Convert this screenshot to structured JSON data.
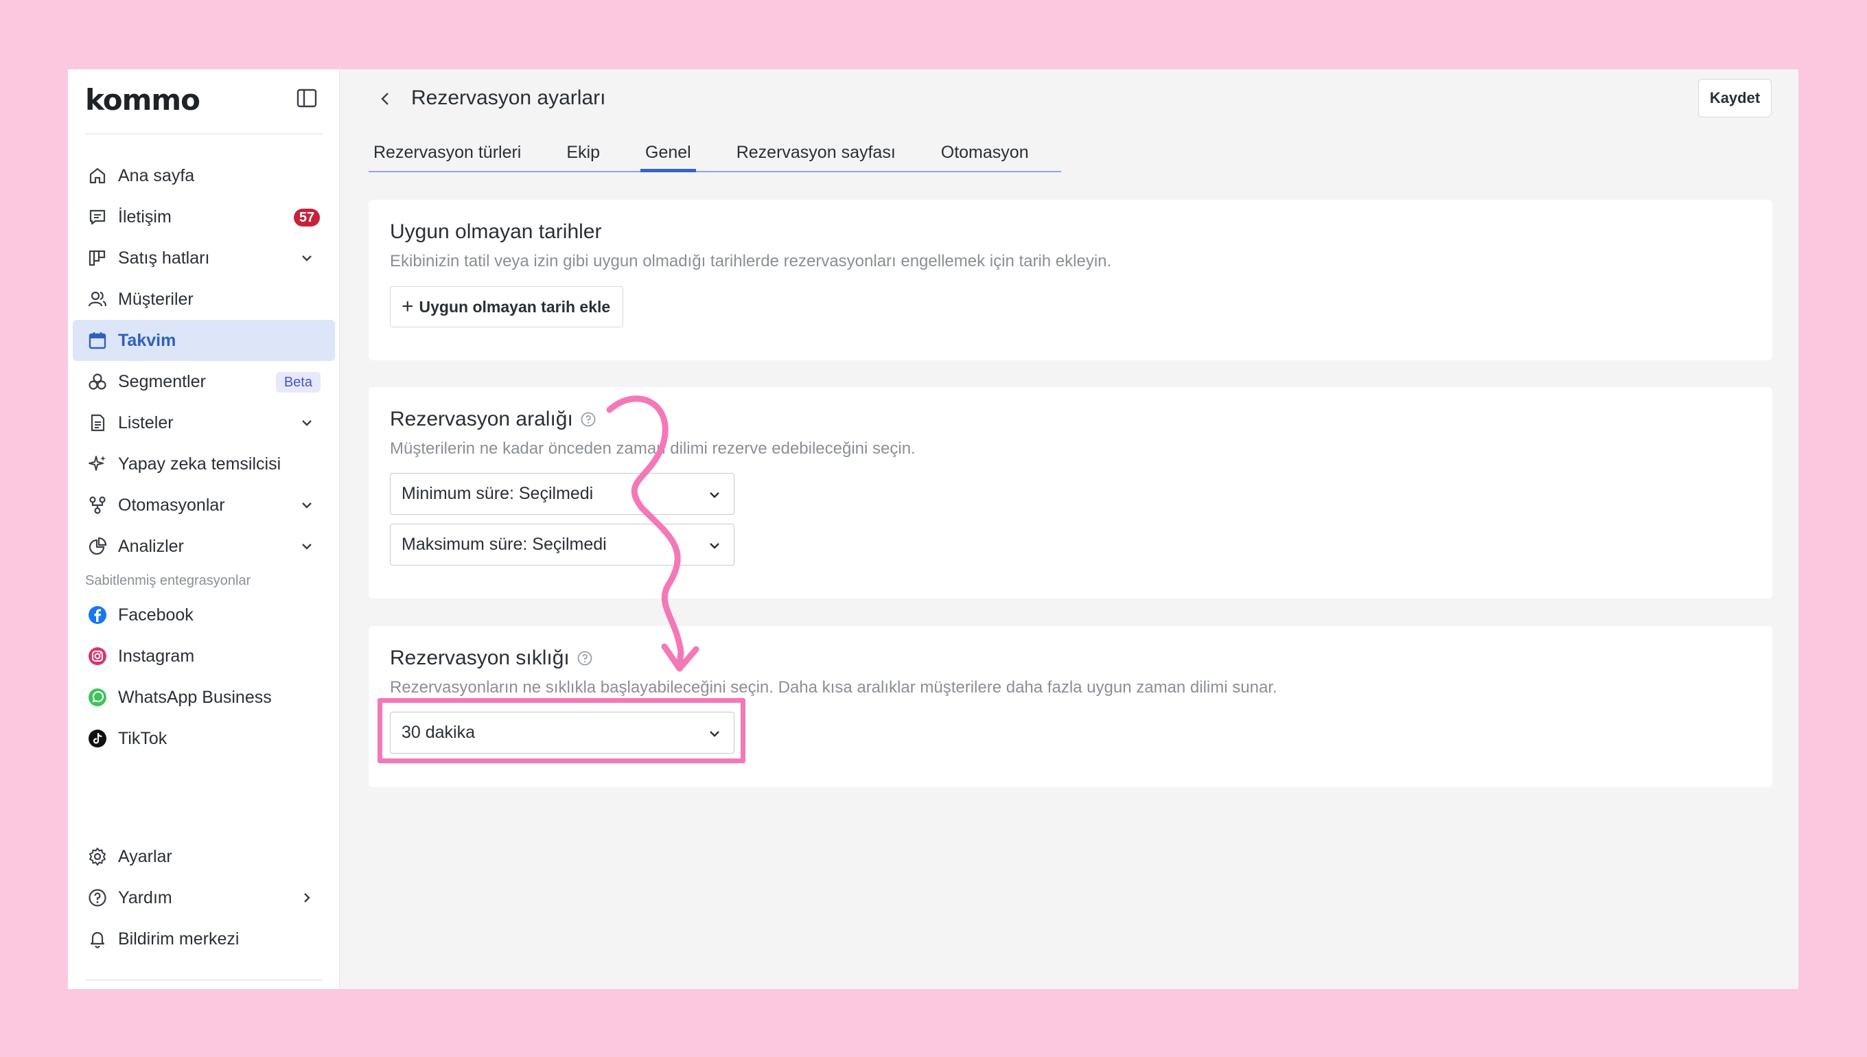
{
  "brand": {
    "logo_text": "kommo"
  },
  "sidebar": {
    "items": [
      {
        "label": "Ana sayfa",
        "icon": "home-icon"
      },
      {
        "label": "İletişim",
        "icon": "chat-icon",
        "badge": "57"
      },
      {
        "label": "Satış hatları",
        "icon": "pipeline-icon",
        "has_chevron": true
      },
      {
        "label": "Müşteriler",
        "icon": "users-icon"
      },
      {
        "label": "Takvim",
        "icon": "calendar-icon",
        "active": true
      },
      {
        "label": "Segmentler",
        "icon": "segments-icon",
        "badge": "Beta"
      },
      {
        "label": "Listeler",
        "icon": "list-icon",
        "has_chevron": true
      },
      {
        "label": "Yapay zeka temsilcisi",
        "icon": "sparkle-icon"
      },
      {
        "label": "Otomasyonlar",
        "icon": "automation-icon",
        "has_chevron": true
      },
      {
        "label": "Analizler",
        "icon": "analytics-icon",
        "has_chevron": true
      }
    ],
    "pinned_section_label": "Sabitlenmiş entegrasyonlar",
    "integrations": [
      {
        "label": "Facebook",
        "icon": "facebook-icon"
      },
      {
        "label": "Instagram",
        "icon": "instagram-icon"
      },
      {
        "label": "WhatsApp Business",
        "icon": "whatsapp-icon"
      },
      {
        "label": "TikTok",
        "icon": "tiktok-icon"
      }
    ],
    "bottom": [
      {
        "label": "Ayarlar",
        "icon": "gear-icon"
      },
      {
        "label": "Yardım",
        "icon": "help-icon"
      },
      {
        "label": "Bildirim merkezi",
        "icon": "bell-icon"
      }
    ]
  },
  "header": {
    "title": "Rezervasyon ayarları",
    "save_label": "Kaydet"
  },
  "tabs": [
    {
      "label": "Rezervasyon türleri"
    },
    {
      "label": "Ekip"
    },
    {
      "label": "Genel",
      "active": true
    },
    {
      "label": "Rezervasyon sayfası"
    },
    {
      "label": "Otomasyon"
    }
  ],
  "unavailable": {
    "title": "Uygun olmayan tarihler",
    "description": "Ekibinizin tatil veya izin gibi uygun olmadığı tarihlerde rezervasyonları engellemek için tarih ekleyin.",
    "add_button": "Uygun olmayan tarih ekle"
  },
  "range": {
    "title": "Rezervasyon aralığı",
    "description": "Müşterilerin ne kadar önceden zaman dilimi rezerve edebileceğini seçin.",
    "min_select": "Minimum süre: Seçilmedi",
    "max_select": "Maksimum süre: Seçilmedi"
  },
  "frequency": {
    "title": "Rezervasyon sıklığı",
    "description": "Rezervasyonların ne sıklıkla başlayabileceğini seçin. Daha kısa aralıklar müşterilere daha fazla uygun zaman dilimi sunar.",
    "selected": "30 dakika"
  },
  "colors": {
    "page_background": "#fcc8e0",
    "accent": "#3564c5",
    "annotation": "#f478b8",
    "badge_red": "#c8213a",
    "ai_button": "#7b6cf6"
  }
}
